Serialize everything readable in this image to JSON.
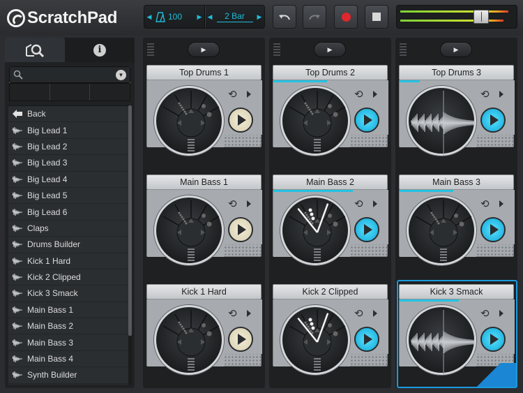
{
  "app": {
    "title": "ScratchPad"
  },
  "transport": {
    "tempo": "100",
    "bars": "2 Bar"
  },
  "browser": {
    "search": {
      "placeholder": "",
      "value": ""
    },
    "items": [
      {
        "label": "Back",
        "icon": "back-arrow-icon"
      },
      {
        "label": "Big Lead 1",
        "icon": "waveform-icon"
      },
      {
        "label": "Big Lead 2",
        "icon": "waveform-icon"
      },
      {
        "label": "Big Lead 3",
        "icon": "waveform-icon"
      },
      {
        "label": "Big Lead 4",
        "icon": "waveform-icon"
      },
      {
        "label": "Big Lead 5",
        "icon": "waveform-icon"
      },
      {
        "label": "Big Lead 6",
        "icon": "waveform-icon"
      },
      {
        "label": "Claps",
        "icon": "waveform-icon"
      },
      {
        "label": "Drums Builder",
        "icon": "waveform-icon"
      },
      {
        "label": "Kick 1 Hard",
        "icon": "waveform-icon"
      },
      {
        "label": "Kick 2 Clipped",
        "icon": "waveform-icon"
      },
      {
        "label": "Kick 3 Smack",
        "icon": "waveform-icon"
      },
      {
        "label": "Main Bass 1",
        "icon": "waveform-icon"
      },
      {
        "label": "Main Bass 2",
        "icon": "waveform-icon"
      },
      {
        "label": "Main Bass 3",
        "icon": "waveform-icon"
      },
      {
        "label": "Main Bass 4",
        "icon": "waveform-icon"
      },
      {
        "label": "Synth Builder",
        "icon": "waveform-icon"
      }
    ]
  },
  "columns": [
    {
      "pads": [
        {
          "title": "Top Drums 1",
          "state": "idle",
          "progress": 0,
          "view": "sequencer"
        },
        {
          "title": "Main Bass 1",
          "state": "idle",
          "progress": 0,
          "view": "sequencer"
        },
        {
          "title": "Kick 1 Hard",
          "state": "idle",
          "progress": 0,
          "view": "sequencer"
        }
      ]
    },
    {
      "pads": [
        {
          "title": "Top Drums 2",
          "state": "playing",
          "progress": 0.47,
          "view": "sequencer"
        },
        {
          "title": "Main Bass 2",
          "state": "playing",
          "progress": 0.7,
          "view": "sequencer-active"
        },
        {
          "title": "Kick 2 Clipped",
          "state": "playing",
          "progress": 0,
          "view": "sequencer-active"
        }
      ]
    },
    {
      "pads": [
        {
          "title": "Top Drums 3",
          "state": "playing",
          "progress": 0.18,
          "view": "waveform"
        },
        {
          "title": "Main Bass 3",
          "state": "playing",
          "progress": 0.47,
          "view": "sequencer"
        },
        {
          "title": "Kick 3 Smack",
          "state": "playing",
          "progress": 0.52,
          "view": "waveform",
          "selected": true
        }
      ]
    }
  ],
  "colors": {
    "accent": "#25c3e4",
    "record": "#e0262f",
    "selection": "#1a9be0"
  },
  "icons": [
    "logo-icon",
    "metronome-icon",
    "undo-icon",
    "redo-icon",
    "record-icon",
    "stop-icon",
    "browser-tab-icon",
    "info-icon",
    "search-icon",
    "dropdown-icon",
    "loop-icon",
    "play-icon"
  ]
}
